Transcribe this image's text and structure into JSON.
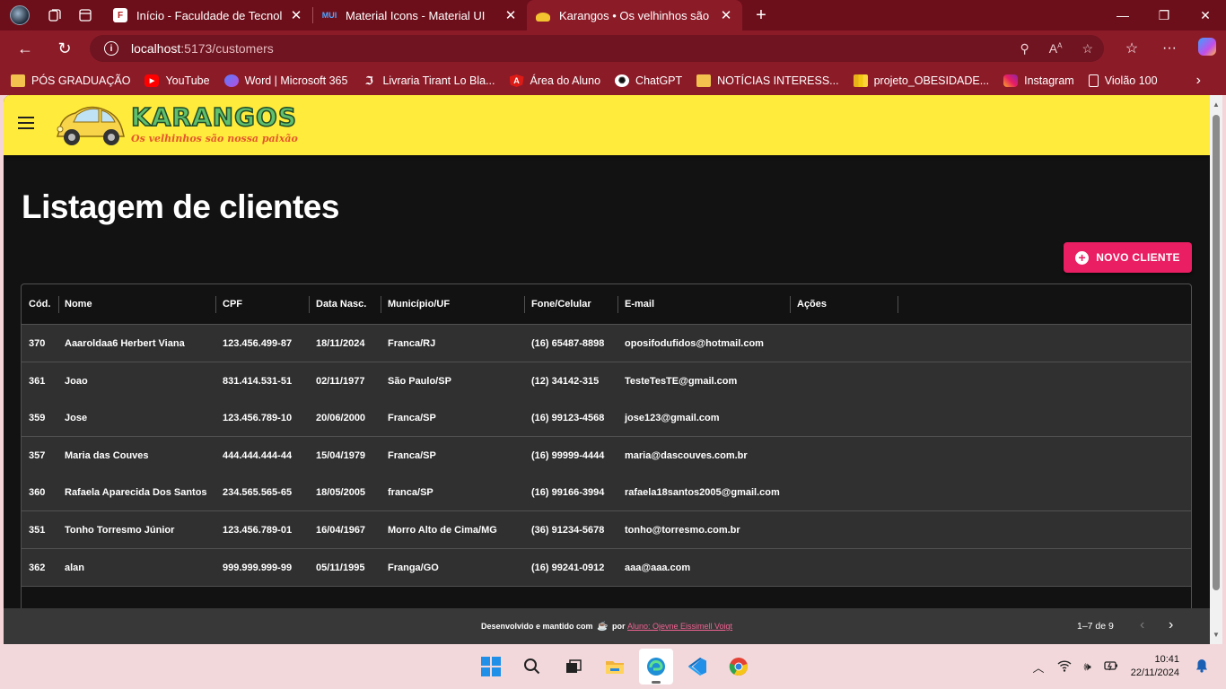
{
  "browser": {
    "tabs": [
      {
        "title": "Início - Faculdade de Tecnologia d",
        "favicon": "F"
      },
      {
        "title": "Material Icons - Material UI",
        "favicon": "MUI"
      },
      {
        "title": "Karangos • Os velhinhos são noss",
        "favicon": "car"
      }
    ],
    "address": {
      "host": "localhost",
      "path": ":5173/customers"
    },
    "bookmarks": [
      {
        "label": "PÓS GRADUAÇÃO",
        "icon": "folder-icon"
      },
      {
        "label": "YouTube",
        "icon": "youtube-icon"
      },
      {
        "label": "Word | Microsoft 365",
        "icon": "word-icon"
      },
      {
        "label": "Livraria Tirant Lo Bla...",
        "icon": "book-icon"
      },
      {
        "label": "Área do Aluno",
        "icon": "angular-icon"
      },
      {
        "label": "ChatGPT",
        "icon": "chatgpt-icon"
      },
      {
        "label": "NOTÍCIAS INTERESS...",
        "icon": "folder-icon"
      },
      {
        "label": "projeto_OBESIDADE...",
        "icon": "powerbi-icon"
      },
      {
        "label": "Instagram",
        "icon": "instagram-icon"
      },
      {
        "label": "Violão 100",
        "icon": "page-icon"
      }
    ]
  },
  "app": {
    "brand": "KARANGOS",
    "slogan": "Os velhinhos são nossa paixão",
    "page_title": "Listagem de clientes",
    "new_button": "NOVO CLIENTE"
  },
  "table": {
    "columns": [
      "Cód.",
      "Nome",
      "CPF",
      "Data Nasc.",
      "Município/UF",
      "Fone/Celular",
      "E-mail",
      "Ações"
    ],
    "rows": [
      [
        "370",
        "Aaaroldaa6 Herbert Viana",
        "123.456.499-87",
        "18/11/2024",
        "Franca/RJ",
        "(16) 65487-8898",
        "oposifodufidos@hotmail.com"
      ],
      [
        "361",
        "Joao",
        "831.414.531-51",
        "02/11/1977",
        "São Paulo/SP",
        "(12) 34142-315",
        "TesteTesTE@gmail.com"
      ],
      [
        "359",
        "Jose",
        "123.456.789-10",
        "20/06/2000",
        "Franca/SP",
        "(16) 99123-4568",
        "jose123@gmail.com"
      ],
      [
        "357",
        "Maria das Couves",
        "444.444.444-44",
        "15/04/1979",
        "Franca/SP",
        "(16) 99999-4444",
        "maria@dascouves.com.br"
      ],
      [
        "360",
        "Rafaela Aparecida Dos Santos",
        "234.565.565-65",
        "18/05/2005",
        "franca/SP",
        "(16) 99166-3994",
        "rafaela18santos2005@gmail.com"
      ],
      [
        "351",
        "Tonho Torresmo Júnior",
        "123.456.789-01",
        "16/04/1967",
        "Morro Alto de Cima/MG",
        "(36) 91234-5678",
        "tonho@torresmo.com.br"
      ],
      [
        "362",
        "alan",
        "999.999.999-99",
        "05/11/1995",
        "Franga/GO",
        "(16) 99241-0912",
        "aaa@aaa.com"
      ]
    ],
    "pagination": "1–7 de 9"
  },
  "footer": {
    "prefix": "Desenvolvido e mantido com",
    "by": "por",
    "author": "Aluno: Ojevne Eissimell Voigt"
  },
  "taskbar": {
    "time": "10:41",
    "date": "22/11/2024"
  },
  "colors": {
    "browser_frame": "#8c1b28",
    "appbar": "#ffeb3b",
    "accent": "#e91e63",
    "page_bg": "#121212",
    "row_bg": "#303030"
  }
}
